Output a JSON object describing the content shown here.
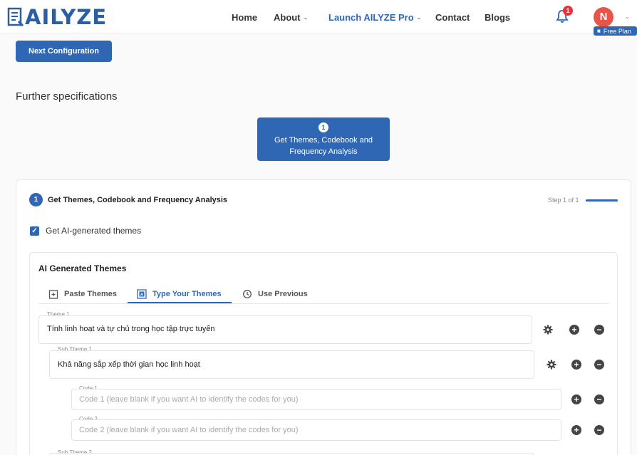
{
  "header": {
    "logo_text": "AILYZE",
    "nav": [
      {
        "label": "Home"
      },
      {
        "label": "About"
      },
      {
        "label": "Launch AILYZE Pro"
      },
      {
        "label": "Contact"
      },
      {
        "label": "Blogs"
      }
    ],
    "notification_count": "1",
    "avatar_initial": "N",
    "plan_label": "Free Plan"
  },
  "next_button_label": "Next Configuration",
  "section_title": "Further specifications",
  "step_card": {
    "number": "1",
    "label": "Get Themes, Codebook and Frequency Analysis"
  },
  "panel": {
    "step_number": "1",
    "title": "Get Themes, Codebook and Frequency Analysis",
    "step_progress": "Step 1 of 1",
    "checkbox_label": "Get AI-generated themes"
  },
  "themes": {
    "title": "AI Generated Themes",
    "tabs": [
      {
        "label": "Paste Themes"
      },
      {
        "label": "Type Your Themes"
      },
      {
        "label": "Use Previous"
      }
    ],
    "theme1": {
      "label": "Theme 1",
      "value": "Tính linh hoạt và tự chủ trong học tập trực tuyến"
    },
    "subtheme1": {
      "label": "Sub Theme 1",
      "value": "Khả năng sắp xếp thời gian học linh hoạt"
    },
    "code1": {
      "label": "Code 1",
      "placeholder": "Code 1 (leave blank if you want AI to identify the codes for you)"
    },
    "code2": {
      "label": "Code 2",
      "placeholder": "Code 2 (leave blank if you want AI to identify the codes for you)"
    },
    "subtheme2_label": "Sub Theme 2"
  },
  "colors": {
    "primary": "#2f67b5",
    "badge": "#e8323a",
    "avatar": "#e95446"
  }
}
